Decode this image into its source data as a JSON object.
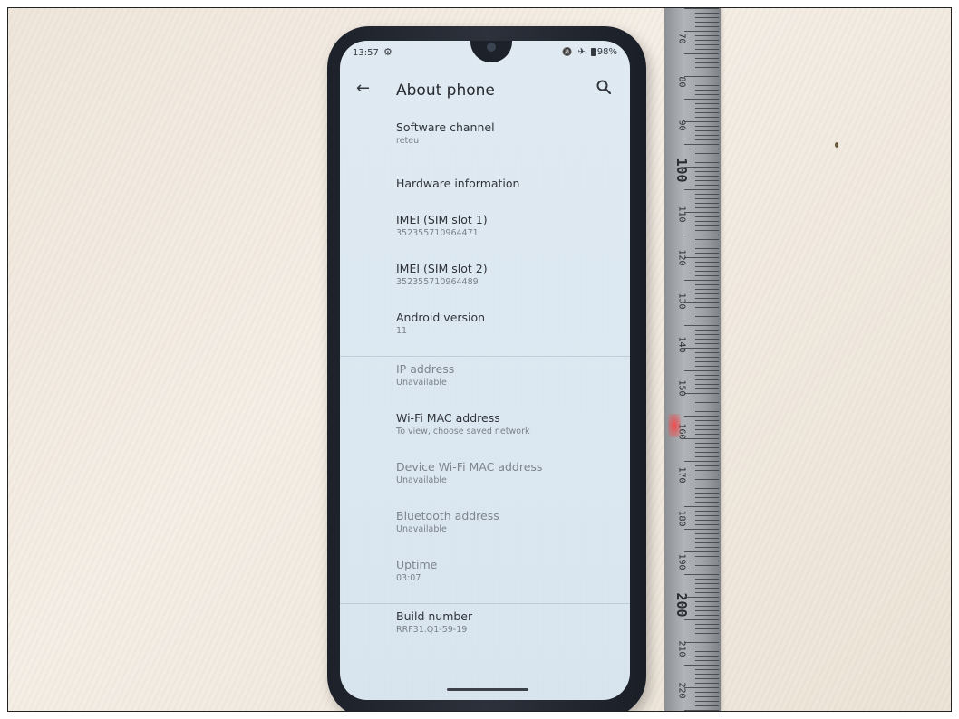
{
  "status_bar": {
    "time": "13:57",
    "gear_glyph": "⚙",
    "mute_glyph": "🔕",
    "airplane_glyph": "✈",
    "battery": "98%"
  },
  "app_bar": {
    "back_glyph": "←",
    "title": "About phone",
    "search_icon": "search-icon"
  },
  "items": [
    {
      "title": "Software channel",
      "value": "reteu"
    },
    {
      "title": "Hardware information"
    },
    {
      "title": "IMEI (SIM slot 1)",
      "value": "352355710964471"
    },
    {
      "title": "IMEI (SIM slot 2)",
      "value": "352355710964489"
    },
    {
      "title": "Android version",
      "value": "11"
    },
    {
      "title": "IP address",
      "value": "Unavailable"
    },
    {
      "title": "Wi-Fi MAC address",
      "value": "To view, choose saved network"
    },
    {
      "title": "Device Wi-Fi MAC address",
      "value": "Unavailable"
    },
    {
      "title": "Bluetooth address",
      "value": "Unavailable"
    },
    {
      "title": "Uptime",
      "value": "03:07"
    },
    {
      "title": "Build number",
      "value": "RRF31.Q1-59-19"
    }
  ],
  "ruler": {
    "marks": [
      "70",
      "80",
      "90",
      "100",
      "110",
      "120",
      "130",
      "140",
      "150",
      "160",
      "170",
      "180",
      "190",
      "200",
      "210",
      "220"
    ]
  },
  "colors": {
    "screen_bg": "#dce8f1",
    "phone_body": "#1d2129",
    "ruler": "#9ea1a5"
  }
}
